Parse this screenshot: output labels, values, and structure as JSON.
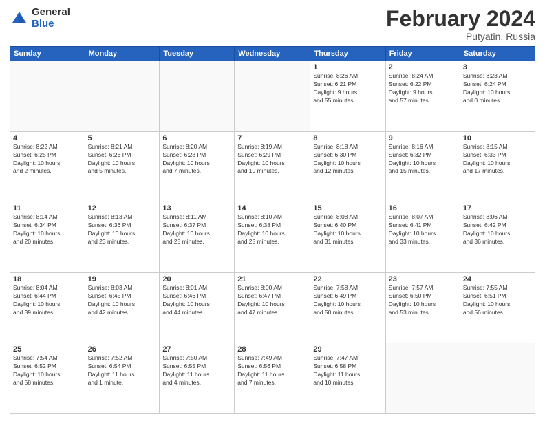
{
  "logo": {
    "general": "General",
    "blue": "Blue"
  },
  "title": "February 2024",
  "location": "Putyatin, Russia",
  "days_of_week": [
    "Sunday",
    "Monday",
    "Tuesday",
    "Wednesday",
    "Thursday",
    "Friday",
    "Saturday"
  ],
  "weeks": [
    [
      {
        "day": "",
        "info": ""
      },
      {
        "day": "",
        "info": ""
      },
      {
        "day": "",
        "info": ""
      },
      {
        "day": "",
        "info": ""
      },
      {
        "day": "1",
        "info": "Sunrise: 8:26 AM\nSunset: 6:21 PM\nDaylight: 9 hours\nand 55 minutes."
      },
      {
        "day": "2",
        "info": "Sunrise: 8:24 AM\nSunset: 6:22 PM\nDaylight: 9 hours\nand 57 minutes."
      },
      {
        "day": "3",
        "info": "Sunrise: 8:23 AM\nSunset: 6:24 PM\nDaylight: 10 hours\nand 0 minutes."
      }
    ],
    [
      {
        "day": "4",
        "info": "Sunrise: 8:22 AM\nSunset: 6:25 PM\nDaylight: 10 hours\nand 2 minutes."
      },
      {
        "day": "5",
        "info": "Sunrise: 8:21 AM\nSunset: 6:26 PM\nDaylight: 10 hours\nand 5 minutes."
      },
      {
        "day": "6",
        "info": "Sunrise: 8:20 AM\nSunset: 6:28 PM\nDaylight: 10 hours\nand 7 minutes."
      },
      {
        "day": "7",
        "info": "Sunrise: 8:19 AM\nSunset: 6:29 PM\nDaylight: 10 hours\nand 10 minutes."
      },
      {
        "day": "8",
        "info": "Sunrise: 8:18 AM\nSunset: 6:30 PM\nDaylight: 10 hours\nand 12 minutes."
      },
      {
        "day": "9",
        "info": "Sunrise: 8:16 AM\nSunset: 6:32 PM\nDaylight: 10 hours\nand 15 minutes."
      },
      {
        "day": "10",
        "info": "Sunrise: 8:15 AM\nSunset: 6:33 PM\nDaylight: 10 hours\nand 17 minutes."
      }
    ],
    [
      {
        "day": "11",
        "info": "Sunrise: 8:14 AM\nSunset: 6:34 PM\nDaylight: 10 hours\nand 20 minutes."
      },
      {
        "day": "12",
        "info": "Sunrise: 8:13 AM\nSunset: 6:36 PM\nDaylight: 10 hours\nand 23 minutes."
      },
      {
        "day": "13",
        "info": "Sunrise: 8:11 AM\nSunset: 6:37 PM\nDaylight: 10 hours\nand 25 minutes."
      },
      {
        "day": "14",
        "info": "Sunrise: 8:10 AM\nSunset: 6:38 PM\nDaylight: 10 hours\nand 28 minutes."
      },
      {
        "day": "15",
        "info": "Sunrise: 8:08 AM\nSunset: 6:40 PM\nDaylight: 10 hours\nand 31 minutes."
      },
      {
        "day": "16",
        "info": "Sunrise: 8:07 AM\nSunset: 6:41 PM\nDaylight: 10 hours\nand 33 minutes."
      },
      {
        "day": "17",
        "info": "Sunrise: 8:06 AM\nSunset: 6:42 PM\nDaylight: 10 hours\nand 36 minutes."
      }
    ],
    [
      {
        "day": "18",
        "info": "Sunrise: 8:04 AM\nSunset: 6:44 PM\nDaylight: 10 hours\nand 39 minutes."
      },
      {
        "day": "19",
        "info": "Sunrise: 8:03 AM\nSunset: 6:45 PM\nDaylight: 10 hours\nand 42 minutes."
      },
      {
        "day": "20",
        "info": "Sunrise: 8:01 AM\nSunset: 6:46 PM\nDaylight: 10 hours\nand 44 minutes."
      },
      {
        "day": "21",
        "info": "Sunrise: 8:00 AM\nSunset: 6:47 PM\nDaylight: 10 hours\nand 47 minutes."
      },
      {
        "day": "22",
        "info": "Sunrise: 7:58 AM\nSunset: 6:49 PM\nDaylight: 10 hours\nand 50 minutes."
      },
      {
        "day": "23",
        "info": "Sunrise: 7:57 AM\nSunset: 6:50 PM\nDaylight: 10 hours\nand 53 minutes."
      },
      {
        "day": "24",
        "info": "Sunrise: 7:55 AM\nSunset: 6:51 PM\nDaylight: 10 hours\nand 56 minutes."
      }
    ],
    [
      {
        "day": "25",
        "info": "Sunrise: 7:54 AM\nSunset: 6:52 PM\nDaylight: 10 hours\nand 58 minutes."
      },
      {
        "day": "26",
        "info": "Sunrise: 7:52 AM\nSunset: 6:54 PM\nDaylight: 11 hours\nand 1 minute."
      },
      {
        "day": "27",
        "info": "Sunrise: 7:50 AM\nSunset: 6:55 PM\nDaylight: 11 hours\nand 4 minutes."
      },
      {
        "day": "28",
        "info": "Sunrise: 7:49 AM\nSunset: 6:56 PM\nDaylight: 11 hours\nand 7 minutes."
      },
      {
        "day": "29",
        "info": "Sunrise: 7:47 AM\nSunset: 6:58 PM\nDaylight: 11 hours\nand 10 minutes."
      },
      {
        "day": "",
        "info": ""
      },
      {
        "day": "",
        "info": ""
      }
    ]
  ]
}
